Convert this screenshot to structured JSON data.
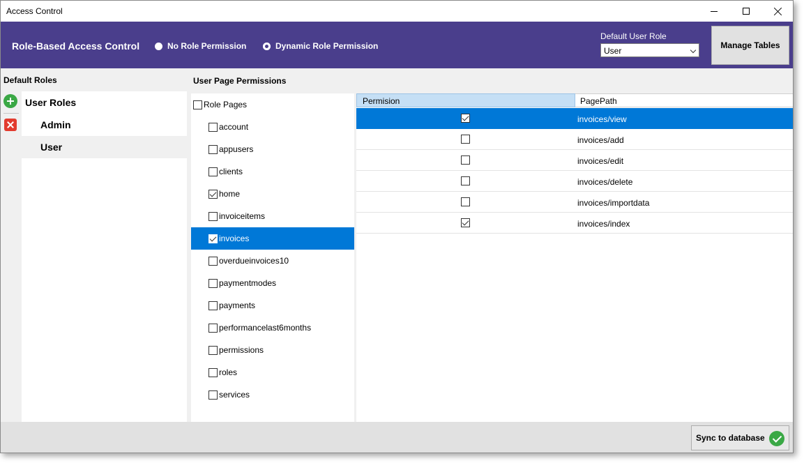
{
  "window": {
    "title": "Access Control"
  },
  "header": {
    "title": "Role-Based Access Control",
    "radio_options": [
      {
        "label": "No Role Permission",
        "selected": false
      },
      {
        "label": "Dynamic Role Permission",
        "selected": true
      }
    ],
    "default_user_role_label": "Default User Role",
    "default_user_role_value": "User",
    "manage_tables_label": "Manage Tables"
  },
  "roles_panel": {
    "label": "Default Roles",
    "tree_root": "User Roles",
    "items": [
      {
        "label": "Admin",
        "selected": false
      },
      {
        "label": "User",
        "selected": true
      }
    ]
  },
  "pages_panel": {
    "label": "User Page Permissions",
    "root_label": "Role Pages",
    "root_checked": false,
    "items": [
      {
        "label": "account",
        "checked": false,
        "selected": false
      },
      {
        "label": "appusers",
        "checked": false,
        "selected": false
      },
      {
        "label": "clients",
        "checked": false,
        "selected": false
      },
      {
        "label": "home",
        "checked": true,
        "selected": false
      },
      {
        "label": "invoiceitems",
        "checked": false,
        "selected": false
      },
      {
        "label": "invoices",
        "checked": true,
        "selected": true
      },
      {
        "label": "overdueinvoices10",
        "checked": false,
        "selected": false
      },
      {
        "label": "paymentmodes",
        "checked": false,
        "selected": false
      },
      {
        "label": "payments",
        "checked": false,
        "selected": false
      },
      {
        "label": "performancelast6months",
        "checked": false,
        "selected": false
      },
      {
        "label": "permissions",
        "checked": false,
        "selected": false
      },
      {
        "label": "roles",
        "checked": false,
        "selected": false
      },
      {
        "label": "services",
        "checked": false,
        "selected": false
      }
    ]
  },
  "grid": {
    "columns": [
      "Permision",
      "PagePath"
    ],
    "rows": [
      {
        "checked": true,
        "path": "invoices/view",
        "selected": true
      },
      {
        "checked": false,
        "path": "invoices/add",
        "selected": false
      },
      {
        "checked": false,
        "path": "invoices/edit",
        "selected": false
      },
      {
        "checked": false,
        "path": "invoices/delete",
        "selected": false
      },
      {
        "checked": false,
        "path": "invoices/importdata",
        "selected": false
      },
      {
        "checked": true,
        "path": "invoices/index",
        "selected": false
      }
    ]
  },
  "footer": {
    "sync_label": "Sync to database"
  },
  "colors": {
    "header_bg": "#4a3e8c",
    "selection": "#0078d7",
    "grid_header": "#c5dff5",
    "success": "#3aa845",
    "danger": "#e23b2e"
  }
}
